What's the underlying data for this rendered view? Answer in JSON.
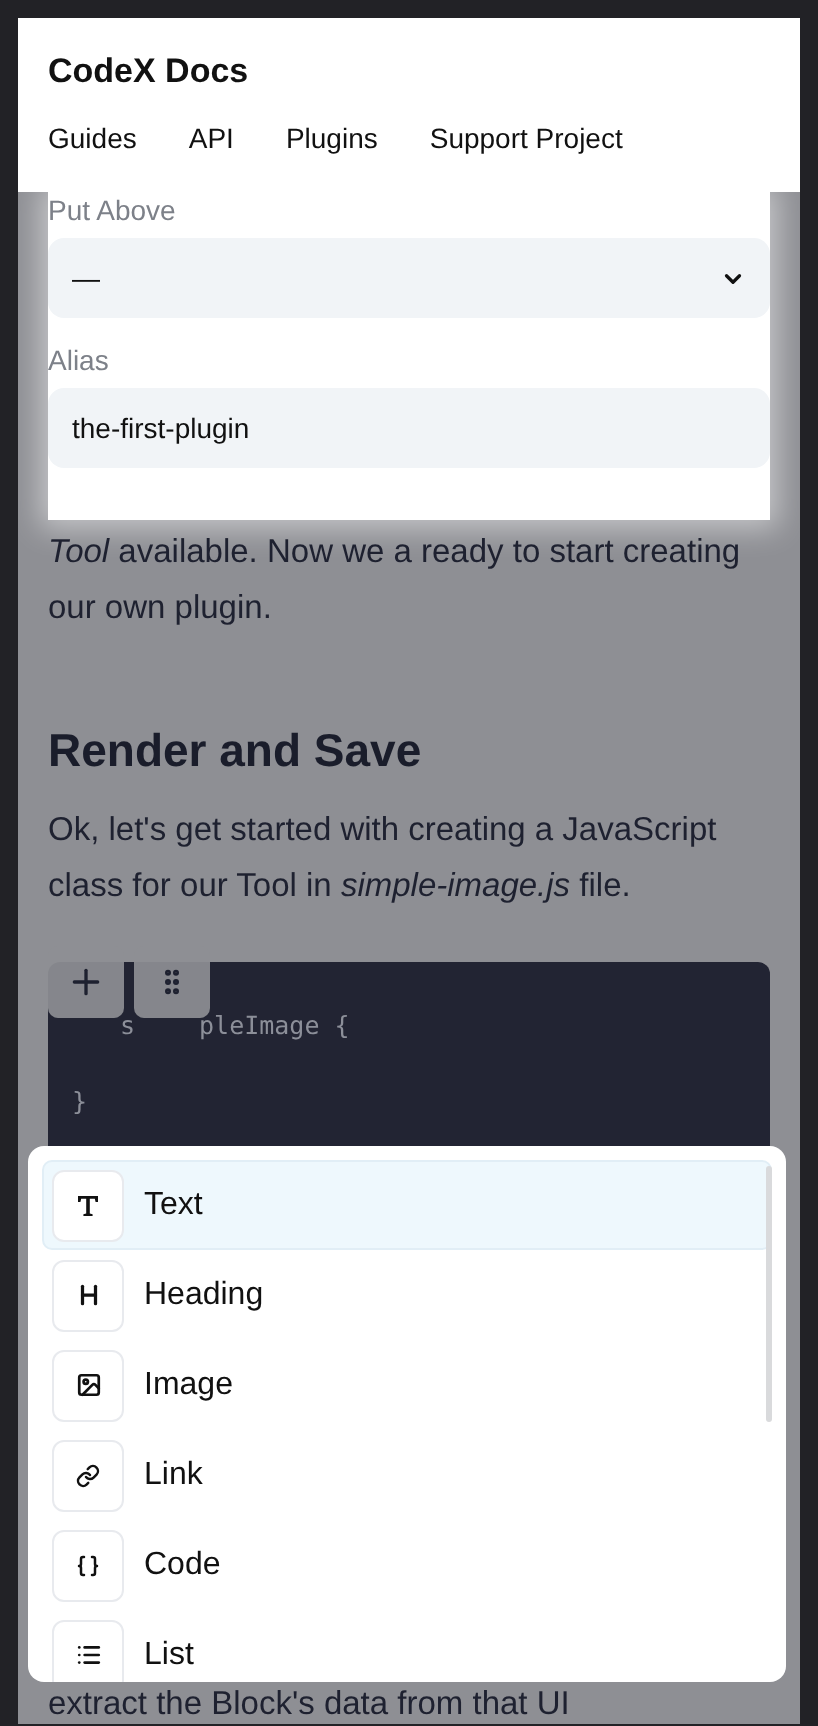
{
  "header": {
    "title": "CodeX Docs",
    "nav": [
      {
        "label": "Guides"
      },
      {
        "label": "API"
      },
      {
        "label": "Plugins"
      },
      {
        "label": "Support Project"
      }
    ]
  },
  "block_settings": {
    "fields": [
      {
        "kind": "select",
        "label": "Put Above",
        "value": "—"
      },
      {
        "kind": "input",
        "label": "Alias",
        "value": "the-first-plugin"
      }
    ]
  },
  "article": {
    "paragraph_1": "*Tool* available. Now we a ready to start creating our own plugin.",
    "heading": "Render and Save",
    "paragraph_2": "Ok, let's get started with creating a JavaScript class for our Tool in *simple-image.js* file.",
    "code_lines": [
      {
        "parts": [
          "s",
          "pleImage {"
        ]
      },
      {
        "parts": [
          "}"
        ]
      }
    ],
    "paragraph_3": "extract the Block's data from that UI"
  },
  "toolbox": {
    "items": [
      {
        "label": "Text",
        "selected": true
      },
      {
        "label": "Heading",
        "selected": false
      },
      {
        "label": "Image",
        "selected": false
      },
      {
        "label": "Link",
        "selected": false
      },
      {
        "label": "Code",
        "selected": false
      },
      {
        "label": "List",
        "selected": false
      }
    ]
  }
}
